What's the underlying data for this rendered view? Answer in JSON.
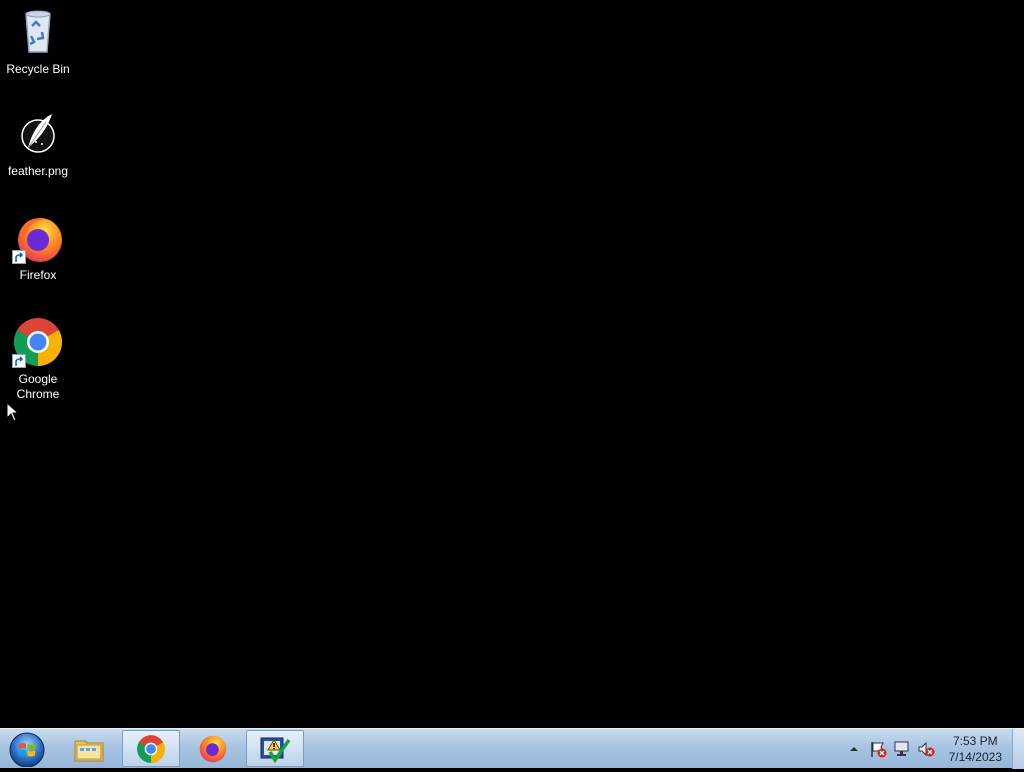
{
  "desktop": {
    "icons": [
      {
        "label": "Recycle Bin",
        "icon": "recycle-bin-icon"
      },
      {
        "label": "feather.png",
        "icon": "feather-image-icon"
      },
      {
        "label": "Firefox",
        "icon": "firefox-icon",
        "shortcut": true
      },
      {
        "label": "Google\nChrome",
        "icon": "chrome-icon",
        "shortcut": true
      }
    ]
  },
  "taskbar": {
    "start": {
      "icon": "windows-start-icon"
    },
    "pinned": [
      {
        "name": "file-explorer",
        "icon": "folder-icon",
        "active": false
      },
      {
        "name": "google-chrome",
        "icon": "chrome-icon",
        "active": true
      },
      {
        "name": "firefox",
        "icon": "firefox-icon",
        "active": false
      },
      {
        "name": "action-center-app",
        "icon": "checklist-warning-icon",
        "active": true
      }
    ],
    "tray": {
      "icons": [
        "show-hidden-icons-arrow",
        "action-center-flag-icon",
        "network-icon",
        "volume-muted-icon"
      ],
      "time": "7:53 PM",
      "date": "7/14/2023"
    }
  },
  "colors": {
    "desktop_background": "#000000",
    "taskbar": "#a9c4e2"
  }
}
